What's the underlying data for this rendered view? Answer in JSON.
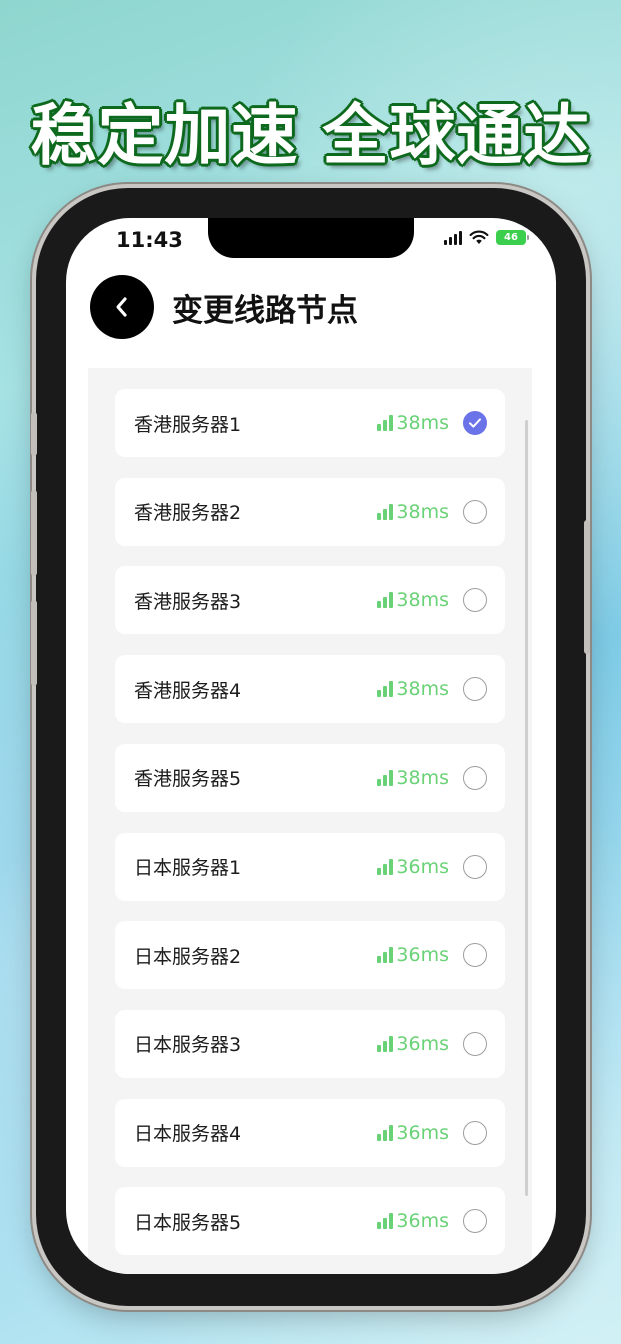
{
  "banner": {
    "headline": "稳定加速 全球通达"
  },
  "status_bar": {
    "time": "11:43",
    "battery": "46"
  },
  "header": {
    "title": "变更线路节点"
  },
  "nodes": [
    {
      "name": "香港服务器1",
      "latency": "38ms",
      "selected": true
    },
    {
      "name": "香港服务器2",
      "latency": "38ms",
      "selected": false
    },
    {
      "name": "香港服务器3",
      "latency": "38ms",
      "selected": false
    },
    {
      "name": "香港服务器4",
      "latency": "38ms",
      "selected": false
    },
    {
      "name": "香港服务器5",
      "latency": "38ms",
      "selected": false
    },
    {
      "name": "日本服务器1",
      "latency": "36ms",
      "selected": false
    },
    {
      "name": "日本服务器2",
      "latency": "36ms",
      "selected": false
    },
    {
      "name": "日本服务器3",
      "latency": "36ms",
      "selected": false
    },
    {
      "name": "日本服务器4",
      "latency": "36ms",
      "selected": false
    },
    {
      "name": "日本服务器5",
      "latency": "36ms",
      "selected": false
    }
  ],
  "colors": {
    "accent": "#6a73e8",
    "latency_green": "#6ad276",
    "headline_outline": "#0e6a1e"
  },
  "icons": {
    "back": "chevron-left-icon",
    "selected": "check-circle-icon",
    "unselected": "radio-empty-icon",
    "signal": "signal-bars-icon"
  }
}
